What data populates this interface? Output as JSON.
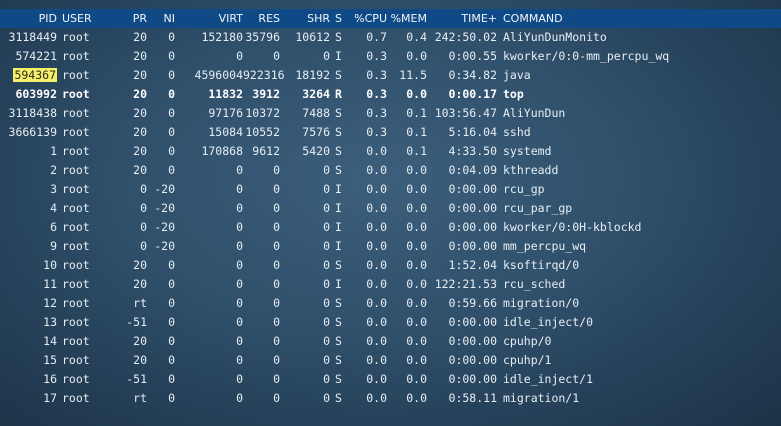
{
  "header": {
    "pid": "PID",
    "user": "USER",
    "pr": "PR",
    "ni": "NI",
    "virt": "VIRT",
    "res": "RES",
    "shr": "SHR",
    "s": "S",
    "cpu": "%CPU",
    "mem": "%MEM",
    "time": "TIME+",
    "command": "COMMAND"
  },
  "processes": [
    {
      "pid": "3118449",
      "user": "root",
      "pr": "20",
      "ni": "0",
      "virt": "152180",
      "res": "35796",
      "shr": "10612",
      "s": "S",
      "cpu": "0.7",
      "mem": "0.4",
      "time": "242:50.02",
      "command": "AliYunDunMonito"
    },
    {
      "pid": "574221",
      "user": "root",
      "pr": "20",
      "ni": "0",
      "virt": "0",
      "res": "0",
      "shr": "0",
      "s": "I",
      "cpu": "0.3",
      "mem": "0.0",
      "time": "0:00.55",
      "command": "kworker/0:0-mm_percpu_wq"
    },
    {
      "pid": "594367",
      "user": "root",
      "pr": "20",
      "ni": "0",
      "virt": "4596004",
      "res": "922316",
      "shr": "18192",
      "s": "S",
      "cpu": "0.3",
      "mem": "11.5",
      "time": "0:34.82",
      "command": "java"
    },
    {
      "pid": "603992",
      "user": "root",
      "pr": "20",
      "ni": "0",
      "virt": "11832",
      "res": "3912",
      "shr": "3264",
      "s": "R",
      "cpu": "0.3",
      "mem": "0.0",
      "time": "0:00.17",
      "command": "top"
    },
    {
      "pid": "3118438",
      "user": "root",
      "pr": "20",
      "ni": "0",
      "virt": "97176",
      "res": "10372",
      "shr": "7488",
      "s": "S",
      "cpu": "0.3",
      "mem": "0.1",
      "time": "103:56.47",
      "command": "AliYunDun"
    },
    {
      "pid": "3666139",
      "user": "root",
      "pr": "20",
      "ni": "0",
      "virt": "15084",
      "res": "10552",
      "shr": "7576",
      "s": "S",
      "cpu": "0.3",
      "mem": "0.1",
      "time": "5:16.04",
      "command": "sshd"
    },
    {
      "pid": "1",
      "user": "root",
      "pr": "20",
      "ni": "0",
      "virt": "170868",
      "res": "9612",
      "shr": "5420",
      "s": "S",
      "cpu": "0.0",
      "mem": "0.1",
      "time": "4:33.50",
      "command": "systemd"
    },
    {
      "pid": "2",
      "user": "root",
      "pr": "20",
      "ni": "0",
      "virt": "0",
      "res": "0",
      "shr": "0",
      "s": "S",
      "cpu": "0.0",
      "mem": "0.0",
      "time": "0:04.09",
      "command": "kthreadd"
    },
    {
      "pid": "3",
      "user": "root",
      "pr": "0",
      "ni": "-20",
      "virt": "0",
      "res": "0",
      "shr": "0",
      "s": "I",
      "cpu": "0.0",
      "mem": "0.0",
      "time": "0:00.00",
      "command": "rcu_gp"
    },
    {
      "pid": "4",
      "user": "root",
      "pr": "0",
      "ni": "-20",
      "virt": "0",
      "res": "0",
      "shr": "0",
      "s": "I",
      "cpu": "0.0",
      "mem": "0.0",
      "time": "0:00.00",
      "command": "rcu_par_gp"
    },
    {
      "pid": "6",
      "user": "root",
      "pr": "0",
      "ni": "-20",
      "virt": "0",
      "res": "0",
      "shr": "0",
      "s": "I",
      "cpu": "0.0",
      "mem": "0.0",
      "time": "0:00.00",
      "command": "kworker/0:0H-kblockd"
    },
    {
      "pid": "9",
      "user": "root",
      "pr": "0",
      "ni": "-20",
      "virt": "0",
      "res": "0",
      "shr": "0",
      "s": "I",
      "cpu": "0.0",
      "mem": "0.0",
      "time": "0:00.00",
      "command": "mm_percpu_wq"
    },
    {
      "pid": "10",
      "user": "root",
      "pr": "20",
      "ni": "0",
      "virt": "0",
      "res": "0",
      "shr": "0",
      "s": "S",
      "cpu": "0.0",
      "mem": "0.0",
      "time": "1:52.04",
      "command": "ksoftirqd/0"
    },
    {
      "pid": "11",
      "user": "root",
      "pr": "20",
      "ni": "0",
      "virt": "0",
      "res": "0",
      "shr": "0",
      "s": "I",
      "cpu": "0.0",
      "mem": "0.0",
      "time": "122:21.53",
      "command": "rcu_sched"
    },
    {
      "pid": "12",
      "user": "root",
      "pr": "rt",
      "ni": "0",
      "virt": "0",
      "res": "0",
      "shr": "0",
      "s": "S",
      "cpu": "0.0",
      "mem": "0.0",
      "time": "0:59.66",
      "command": "migration/0"
    },
    {
      "pid": "13",
      "user": "root",
      "pr": "-51",
      "ni": "0",
      "virt": "0",
      "res": "0",
      "shr": "0",
      "s": "S",
      "cpu": "0.0",
      "mem": "0.0",
      "time": "0:00.00",
      "command": "idle_inject/0"
    },
    {
      "pid": "14",
      "user": "root",
      "pr": "20",
      "ni": "0",
      "virt": "0",
      "res": "0",
      "shr": "0",
      "s": "S",
      "cpu": "0.0",
      "mem": "0.0",
      "time": "0:00.00",
      "command": "cpuhp/0"
    },
    {
      "pid": "15",
      "user": "root",
      "pr": "20",
      "ni": "0",
      "virt": "0",
      "res": "0",
      "shr": "0",
      "s": "S",
      "cpu": "0.0",
      "mem": "0.0",
      "time": "0:00.00",
      "command": "cpuhp/1"
    },
    {
      "pid": "16",
      "user": "root",
      "pr": "-51",
      "ni": "0",
      "virt": "0",
      "res": "0",
      "shr": "0",
      "s": "S",
      "cpu": "0.0",
      "mem": "0.0",
      "time": "0:00.00",
      "command": "idle_inject/1"
    },
    {
      "pid": "17",
      "user": "root",
      "pr": "rt",
      "ni": "0",
      "virt": "0",
      "res": "0",
      "shr": "0",
      "s": "S",
      "cpu": "0.0",
      "mem": "0.0",
      "time": "0:58.11",
      "command": "migration/1"
    }
  ],
  "colors": {
    "header_bg": "#0f4a86",
    "pid_highlight": "#f5ef6a",
    "text": "#e7eef4"
  }
}
